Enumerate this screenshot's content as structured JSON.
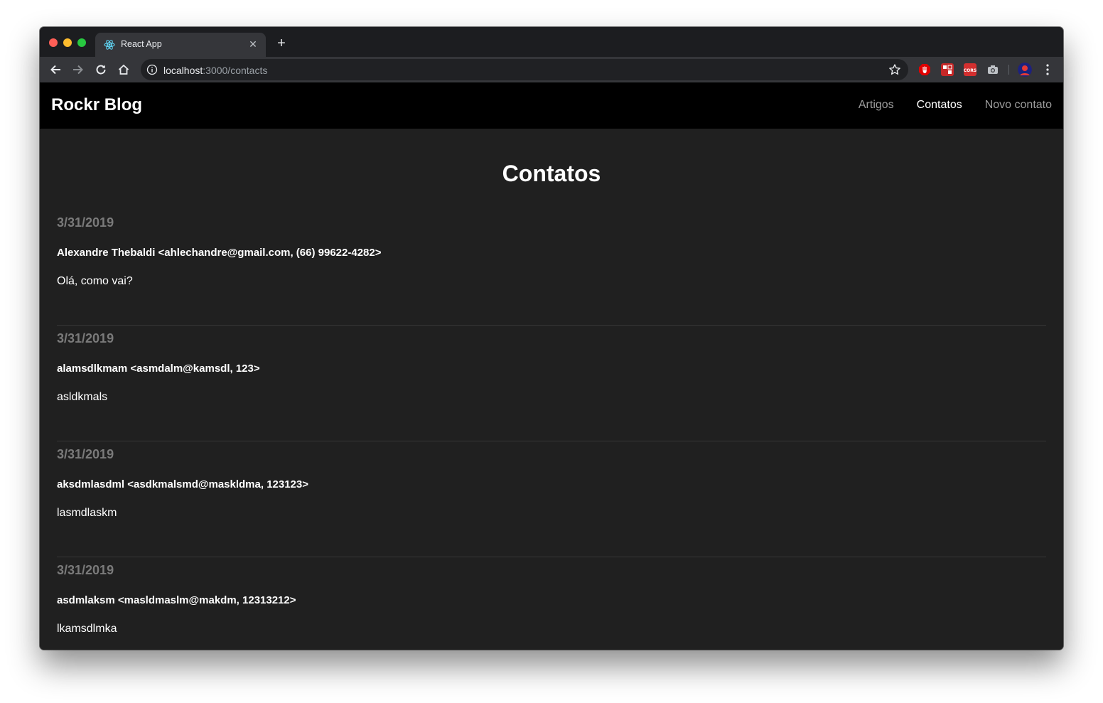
{
  "browser": {
    "tab_title": "React App",
    "tab_icon": "react-logo-icon",
    "url_host": "localhost",
    "url_rest": ":3000/contacts",
    "new_tab_label": "+"
  },
  "navbar": {
    "brand": "Rockr Blog",
    "links": [
      {
        "label": "Artigos",
        "active": false
      },
      {
        "label": "Contatos",
        "active": true
      },
      {
        "label": "Novo contato",
        "active": false
      }
    ]
  },
  "main": {
    "title": "Contatos",
    "contacts": [
      {
        "date": "3/31/2019",
        "from": "Alexandre Thebaldi <ahlechandre@gmail.com, (66) 99622-4282>",
        "message": "Olá, como vai?"
      },
      {
        "date": "3/31/2019",
        "from": "alamsdlkmam <asmdalm@kamsdl, 123>",
        "message": "asldkmals"
      },
      {
        "date": "3/31/2019",
        "from": "aksdmlasdml <asdkmalsmd@maskldma, 123123>",
        "message": "lasmdlaskm"
      },
      {
        "date": "3/31/2019",
        "from": "asdmlaksm <masldmaslm@makdm, 12313212>",
        "message": "lkamsdlmka"
      }
    ]
  },
  "colors": {
    "navbar_bg": "#000000",
    "page_bg": "#202020",
    "date_text": "#7a7a7a",
    "nav_inactive": "#9d9d9d"
  }
}
